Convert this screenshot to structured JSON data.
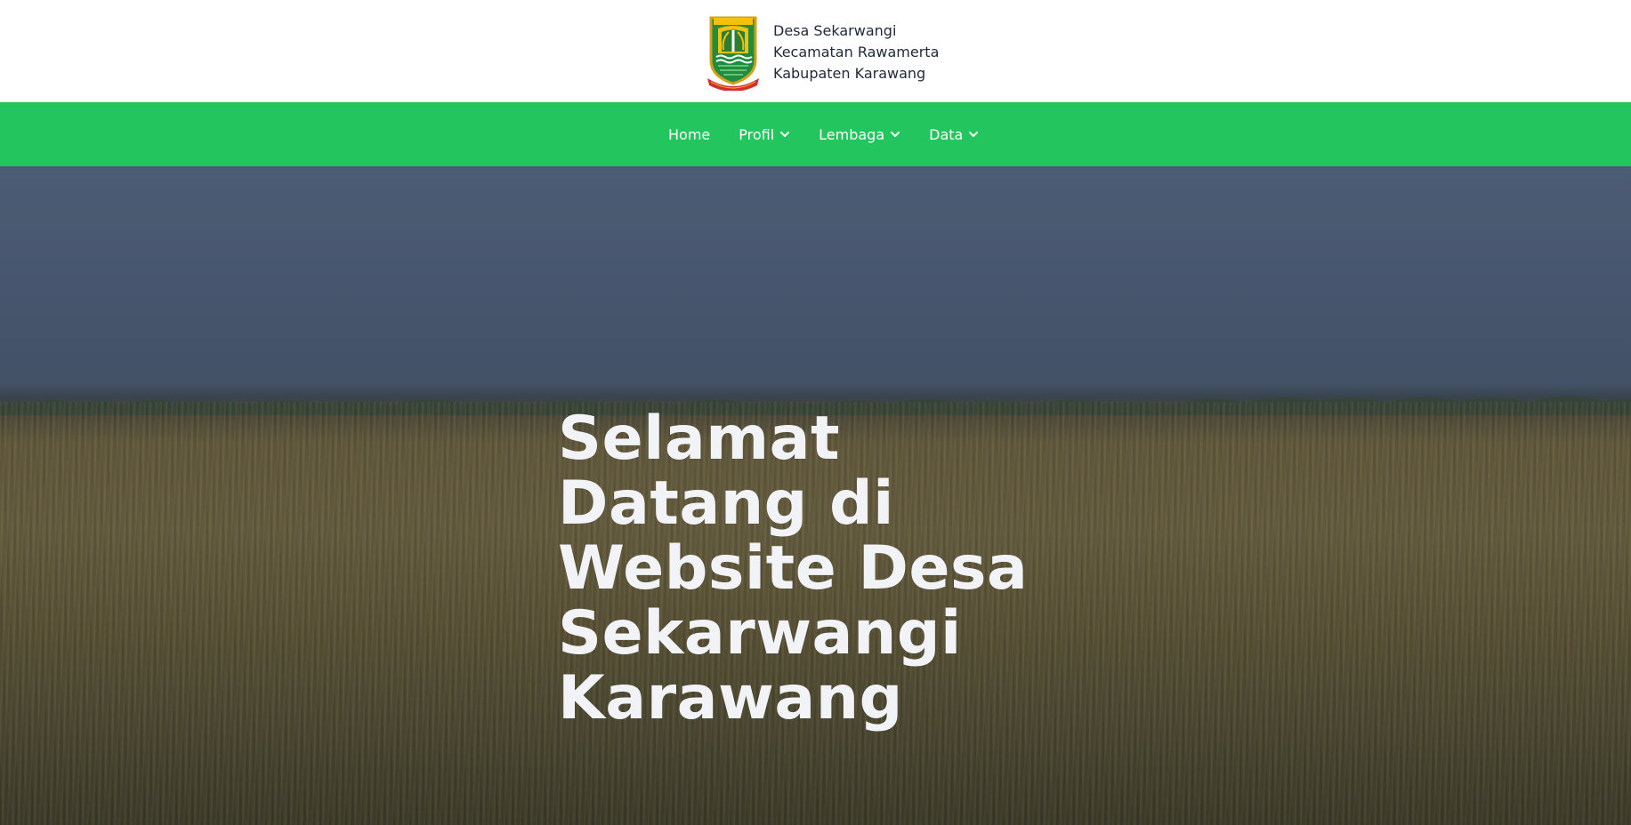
{
  "header": {
    "logo_icon": "karawang-regency-emblem-icon",
    "lines": [
      "Desa Sekarwangi",
      "Kecamatan Rawamerta",
      "Kabupaten Karawang"
    ]
  },
  "nav": {
    "items": [
      {
        "label": "Home",
        "has_dropdown": false
      },
      {
        "label": "Profil",
        "has_dropdown": true
      },
      {
        "label": "Lembaga",
        "has_dropdown": true
      },
      {
        "label": "Data",
        "has_dropdown": true
      }
    ],
    "dropdown_icon": "chevron-down-icon"
  },
  "hero": {
    "title": "Selamat Datang di Website Desa Sekarwangi Karawang",
    "background": "rice-field-photo"
  },
  "colors": {
    "nav_bg": "#22c55e",
    "header_bg": "#ffffff",
    "header_text": "#1f2937",
    "hero_text": "#f1f3f7"
  }
}
